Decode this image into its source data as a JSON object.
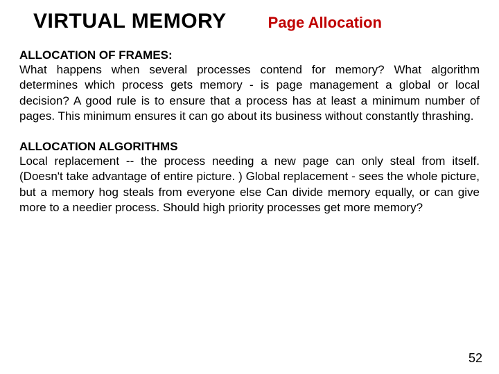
{
  "header": {
    "title": "VIRTUAL MEMORY",
    "subtitle": "Page Allocation"
  },
  "section1": {
    "heading": "ALLOCATION OF FRAMES:",
    "body": "What happens when several processes contend for memory? What algorithm determines which process gets memory - is page management a global or local decision?\nA good rule is to ensure that a process has at least a minimum number of pages.  This minimum ensures it can go about its business without constantly thrashing."
  },
  "section2": {
    "heading": "ALLOCATION ALGORITHMS",
    "body": "Local replacement -- the process needing a new page can only steal from itself. (Doesn't take advantage of entire picture. )\nGlobal replacement - sees the whole picture, but a memory hog steals from everyone else\nCan divide memory equally, or can give more to a needier process. Should high priority processes get more memory?"
  },
  "pageNumber": "52"
}
